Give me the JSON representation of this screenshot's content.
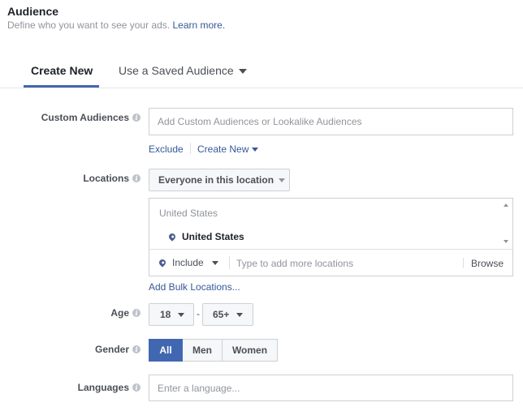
{
  "header": {
    "title": "Audience",
    "subtitle": "Define who you want to see your ads.",
    "learn_more": "Learn more."
  },
  "tabs": [
    {
      "label": "Create New",
      "active": true
    },
    {
      "label": "Use a Saved Audience",
      "active": false
    }
  ],
  "custom_audiences": {
    "label": "Custom Audiences",
    "placeholder": "Add Custom Audiences or Lookalike Audiences",
    "exclude": "Exclude",
    "create_new": "Create New"
  },
  "locations": {
    "label": "Locations",
    "dropdown": "Everyone in this location",
    "list_header": "United States",
    "selected": "United States",
    "include": "Include",
    "placeholder": "Type to add more locations",
    "browse": "Browse",
    "bulk": "Add Bulk Locations..."
  },
  "age": {
    "label": "Age",
    "min": "18",
    "separator": "-",
    "max": "65+"
  },
  "gender": {
    "label": "Gender",
    "options": [
      "All",
      "Men",
      "Women"
    ],
    "selected": "All"
  },
  "languages": {
    "label": "Languages",
    "placeholder": "Enter a language..."
  },
  "colors": {
    "accent": "#4267b2",
    "link": "#365899"
  }
}
